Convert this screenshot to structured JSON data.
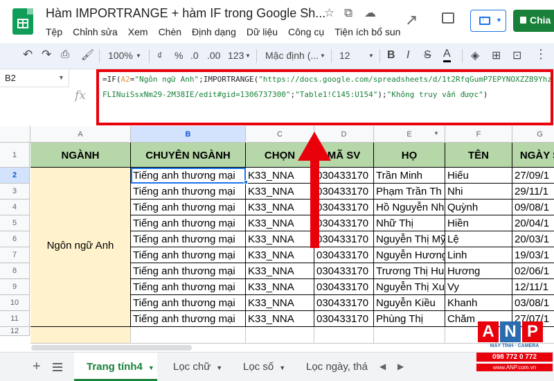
{
  "document": {
    "title": "Hàm IMPORTRANGE + hàm IF trong Google Sh...",
    "menu": [
      "Tệp",
      "Chỉnh sửa",
      "Xem",
      "Chèn",
      "Định dạng",
      "Dữ liệu",
      "Công cụ",
      "Tiện ích bổ sun"
    ],
    "share_label": "Chia"
  },
  "toolbar": {
    "zoom": "100%",
    "currency": "₫",
    "percent": "%",
    "decimal_decrease": ".0",
    "decimal_increase": ".00",
    "number_format": "123",
    "font": "Mặc định (...",
    "font_size": "12",
    "bold": "B",
    "italic": "I",
    "strike": "S",
    "text_color": "A"
  },
  "formula_bar": {
    "cell_ref": "B2",
    "fx": "fx",
    "formula_parts": [
      {
        "t": "=IF(",
        "c": "plain"
      },
      {
        "t": "A2",
        "c": "ref"
      },
      {
        "t": "=",
        "c": "plain"
      },
      {
        "t": "\"Ngôn ngữ Anh\"",
        "c": "str"
      },
      {
        "t": ";IMPORTRANGE(",
        "c": "plain"
      },
      {
        "t": "\"https://docs.google.com/spreadsheets/d/1t2RfqGumP7EPYNOXZZ89YhzFLINuiSsxNm29-2M38IE/edit#gid=1306737300\"",
        "c": "str"
      },
      {
        "t": ";",
        "c": "plain"
      },
      {
        "t": "\"Table1!C145:U154\"",
        "c": "str"
      },
      {
        "t": ");",
        "c": "plain"
      },
      {
        "t": "\"Không truy vấn được\"",
        "c": "str"
      },
      {
        "t": ")",
        "c": "plain"
      }
    ]
  },
  "grid": {
    "columns": [
      "A",
      "B",
      "C",
      "D",
      "E",
      "F",
      "G"
    ],
    "rows": [
      "1",
      "2",
      "3",
      "4",
      "5",
      "6",
      "7",
      "8",
      "9",
      "10",
      "11",
      "12"
    ],
    "headers": [
      "NGÀNH",
      "CHUYÊN NGÀNH",
      "CHỌN",
      "MÃ SV",
      "HỌ",
      "TÊN",
      "NGÀY S"
    ],
    "merged_a": "Ngôn ngữ Anh",
    "data": [
      [
        "Tiếng anh thương mại",
        "K33_NNA",
        "030433170",
        "Trần Minh",
        "Hiếu",
        "27/09/1"
      ],
      [
        "Tiếng anh thương mại",
        "K33_NNA",
        "030433170",
        "Phạm Trần Th",
        "Nhi",
        "29/11/1"
      ],
      [
        "Tiếng anh thương mại",
        "K33_NNA",
        "030433170",
        "Hồ Nguyễn Nh",
        "Quỳnh",
        "09/08/1"
      ],
      [
        "Tiếng anh thương mại",
        "K33_NNA",
        "030433170",
        "Nhữ Thị",
        "Hiền",
        "20/04/1"
      ],
      [
        "Tiếng anh thương mại",
        "K33_NNA",
        "030433170",
        "Nguyễn Thị Mỹ",
        "Lệ",
        "20/03/1"
      ],
      [
        "Tiếng anh thương mại",
        "K33_NNA",
        "030433170",
        "Nguyễn Hương",
        "Linh",
        "19/03/1"
      ],
      [
        "Tiếng anh thương mại",
        "K33_NNA",
        "030433170",
        "Trương Thị Hu",
        "Hương",
        "02/06/1"
      ],
      [
        "Tiếng anh thương mại",
        "K33_NNA",
        "030433170",
        "Nguyễn Thị Xu",
        "Vy",
        "12/11/1"
      ],
      [
        "Tiếng anh thương mại",
        "K33_NNA",
        "030433170",
        "Nguyễn Kiều",
        "Khanh",
        "03/08/1"
      ],
      [
        "Tiếng anh thương mại",
        "K33_NNA",
        "030433170",
        "Phùng Thị",
        "Chăm",
        "27/07/1"
      ]
    ]
  },
  "sheets": {
    "tabs": [
      "Trang tính4",
      "Lọc chữ",
      "Lọc số",
      "Lọc ngày, thá"
    ],
    "active": 0
  },
  "watermark": {
    "letters": [
      "A",
      "N",
      "P"
    ],
    "colors": [
      "#e8000b",
      "#2b6cb0",
      "#e8000b"
    ],
    "tagline": "MÁY TÍNH · CAMERA",
    "phone": "098 772 0 772",
    "site": "www.ANP.com.vn"
  }
}
